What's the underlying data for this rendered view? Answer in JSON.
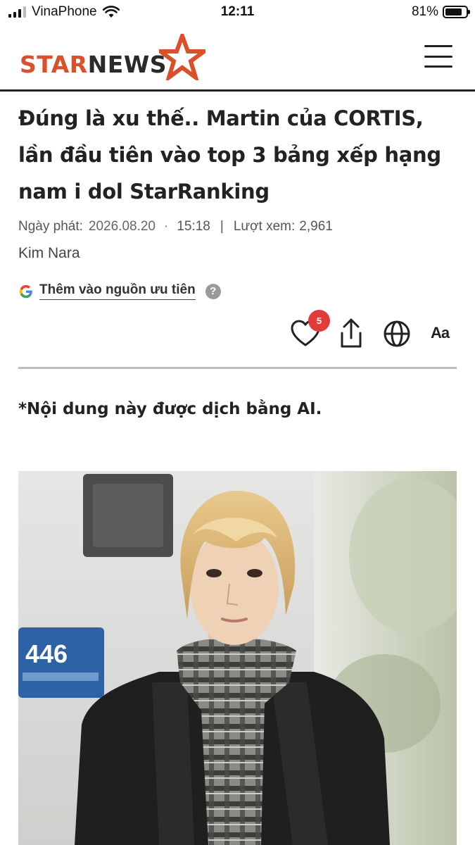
{
  "status_bar": {
    "carrier": "VinaPhone",
    "time": "12:11",
    "battery_percent": "81%",
    "battery_level": 0.81
  },
  "header": {
    "logo_star": "STAR",
    "logo_news": "NEWS",
    "menu_icon": "hamburger-menu-icon",
    "brand_color": "#d9502b"
  },
  "article": {
    "title": "Đúng là xu thế.. Martin của CORTIS, lần đầu tiên vào top 3 bảng xếp hạng nam i dol StarRanking",
    "published_label": "Ngày phát:",
    "date": "2026.08.20",
    "time": "15:18",
    "views_label": "Lượt xem:",
    "views": "2,961",
    "author": "Kim Nara",
    "google_source_label": "Thêm vào nguồn ưu tiên",
    "help": "?",
    "like_count": "5",
    "font_size_label": "Aa",
    "ai_note": "*Nội dung này được dịch bằng AI."
  },
  "icons": {
    "like": "heart-icon",
    "share": "share-icon",
    "translate": "globe-icon",
    "font_size": "font-size-icon"
  },
  "photo": {
    "sign_text": "446"
  }
}
